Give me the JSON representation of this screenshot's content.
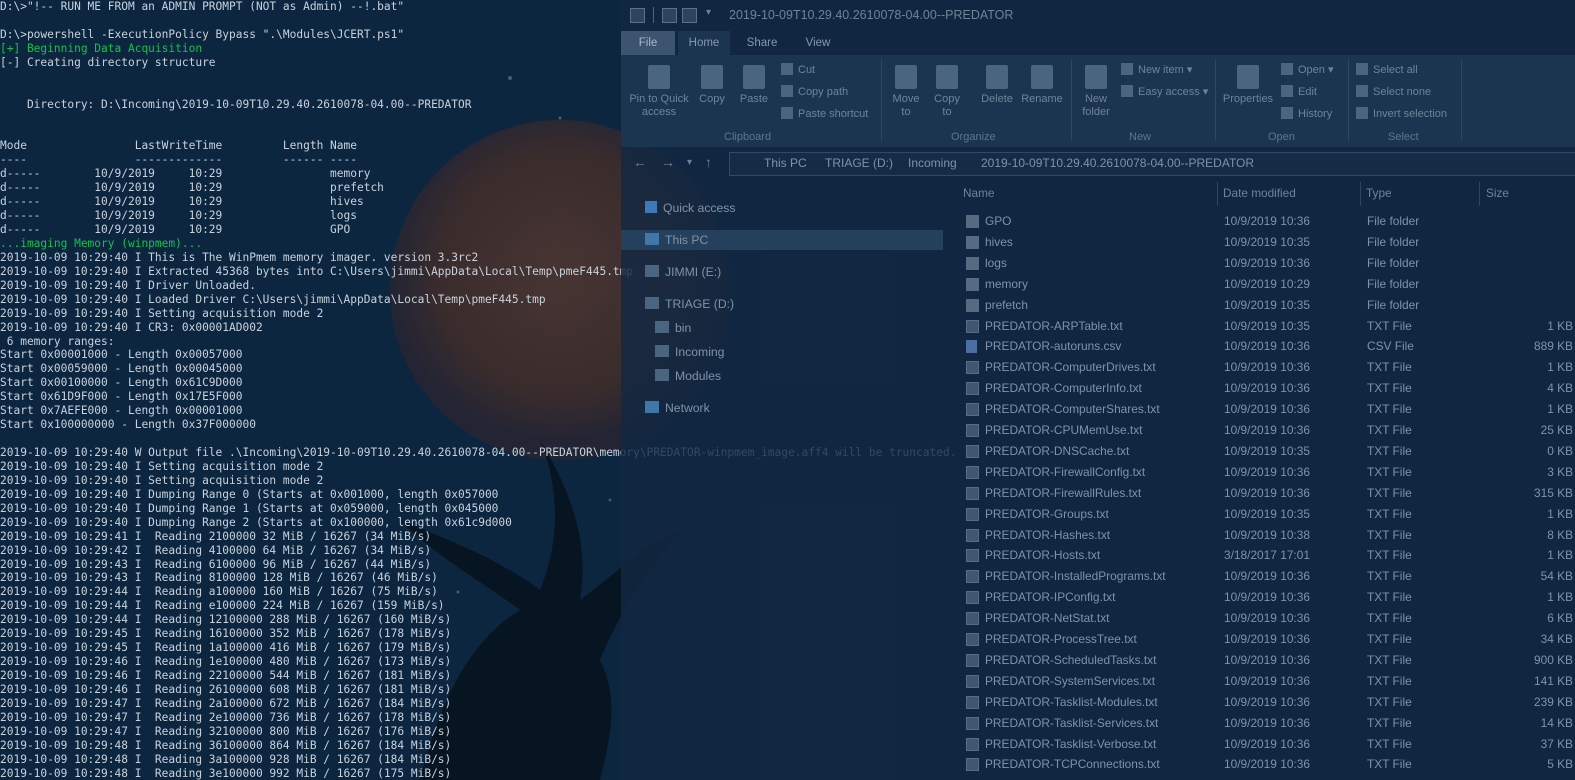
{
  "terminal": {
    "lines": [
      {
        "text": "D:\\>\"!-- RUN ME FROM an ADMIN PROMPT (NOT as Admin) --!.bat\"",
        "color": "normal"
      },
      {
        "text": "",
        "color": "normal"
      },
      {
        "text": "D:\\>powershell -ExecutionPolicy Bypass \".\\Modules\\JCERT.ps1\"",
        "color": "normal"
      },
      {
        "text": "[+] Beginning Data Acquisition",
        "color": "green"
      },
      {
        "text": "[-] Creating directory structure",
        "color": "normal"
      },
      {
        "text": "",
        "color": "normal"
      },
      {
        "text": "",
        "color": "normal"
      },
      {
        "text": "    Directory: D:\\Incoming\\2019-10-09T10.29.40.2610078-04.00--PREDATOR",
        "color": "normal"
      },
      {
        "text": "",
        "color": "normal"
      },
      {
        "text": "",
        "color": "normal"
      },
      {
        "text": "Mode                LastWriteTime         Length Name",
        "color": "normal"
      },
      {
        "text": "----                -------------         ------ ----",
        "color": "normal"
      },
      {
        "text": "d-----        10/9/2019     10:29                memory",
        "color": "normal"
      },
      {
        "text": "d-----        10/9/2019     10:29                prefetch",
        "color": "normal"
      },
      {
        "text": "d-----        10/9/2019     10:29                hives",
        "color": "normal"
      },
      {
        "text": "d-----        10/9/2019     10:29                logs",
        "color": "normal"
      },
      {
        "text": "d-----        10/9/2019     10:29                GPO",
        "color": "normal"
      },
      {
        "text": "...imaging Memory (winpmem)...",
        "color": "green"
      },
      {
        "text": "2019-10-09 10:29:40 I This is The WinPmem memory imager. version 3.3rc2",
        "color": "normal"
      },
      {
        "text": "2019-10-09 10:29:40 I Extracted 45368 bytes into C:\\Users\\jimmi\\AppData\\Local\\Temp\\pmeF445.tmp",
        "color": "normal"
      },
      {
        "text": "2019-10-09 10:29:40 I Driver Unloaded.",
        "color": "normal"
      },
      {
        "text": "2019-10-09 10:29:40 I Loaded Driver C:\\Users\\jimmi\\AppData\\Local\\Temp\\pmeF445.tmp",
        "color": "normal"
      },
      {
        "text": "2019-10-09 10:29:40 I Setting acquisition mode 2",
        "color": "normal"
      },
      {
        "text": "2019-10-09 10:29:40 I CR3: 0x00001AD002",
        "color": "normal"
      },
      {
        "text": " 6 memory ranges:",
        "color": "normal"
      },
      {
        "text": "Start 0x00001000 - Length 0x00057000",
        "color": "normal"
      },
      {
        "text": "Start 0x00059000 - Length 0x00045000",
        "color": "normal"
      },
      {
        "text": "Start 0x00100000 - Length 0x61C9D000",
        "color": "normal"
      },
      {
        "text": "Start 0x61D9F000 - Length 0x17E5F000",
        "color": "normal"
      },
      {
        "text": "Start 0x7AEFE000 - Length 0x00001000",
        "color": "normal"
      },
      {
        "text": "Start 0x100000000 - Length 0x37F000000",
        "color": "normal"
      },
      {
        "text": "",
        "color": "normal"
      },
      {
        "text": "2019-10-09 10:29:40 W Output file .\\Incoming\\2019-10-09T10.29.40.2610078-04.00--PREDATOR\\memory\\PREDATOR-winpmem_image.aff4 will be truncated.",
        "color": "normal"
      },
      {
        "text": "2019-10-09 10:29:40 I Setting acquisition mode 2",
        "color": "normal"
      },
      {
        "text": "2019-10-09 10:29:40 I Setting acquisition mode 2",
        "color": "normal"
      },
      {
        "text": "2019-10-09 10:29:40 I Dumping Range 0 (Starts at 0x001000, length 0x057000",
        "color": "normal"
      },
      {
        "text": "2019-10-09 10:29:40 I Dumping Range 1 (Starts at 0x059000, length 0x045000",
        "color": "normal"
      },
      {
        "text": "2019-10-09 10:29:40 I Dumping Range 2 (Starts at 0x100000, length 0x61c9d000",
        "color": "normal"
      },
      {
        "text": "2019-10-09 10:29:41 I  Reading 2100000 32 MiB / 16267 (34 MiB/s)",
        "color": "normal"
      },
      {
        "text": "2019-10-09 10:29:42 I  Reading 4100000 64 MiB / 16267 (34 MiB/s)",
        "color": "normal"
      },
      {
        "text": "2019-10-09 10:29:43 I  Reading 6100000 96 MiB / 16267 (44 MiB/s)",
        "color": "normal"
      },
      {
        "text": "2019-10-09 10:29:43 I  Reading 8100000 128 MiB / 16267 (46 MiB/s)",
        "color": "normal"
      },
      {
        "text": "2019-10-09 10:29:44 I  Reading a100000 160 MiB / 16267 (75 MiB/s)",
        "color": "normal"
      },
      {
        "text": "2019-10-09 10:29:44 I  Reading e100000 224 MiB / 16267 (159 MiB/s)",
        "color": "normal"
      },
      {
        "text": "2019-10-09 10:29:44 I  Reading 12100000 288 MiB / 16267 (160 MiB/s)",
        "color": "normal"
      },
      {
        "text": "2019-10-09 10:29:45 I  Reading 16100000 352 MiB / 16267 (178 MiB/s)",
        "color": "normal"
      },
      {
        "text": "2019-10-09 10:29:45 I  Reading 1a100000 416 MiB / 16267 (179 MiB/s)",
        "color": "normal"
      },
      {
        "text": "2019-10-09 10:29:46 I  Reading 1e100000 480 MiB / 16267 (173 MiB/s)",
        "color": "normal"
      },
      {
        "text": "2019-10-09 10:29:46 I  Reading 22100000 544 MiB / 16267 (181 MiB/s)",
        "color": "normal"
      },
      {
        "text": "2019-10-09 10:29:46 I  Reading 26100000 608 MiB / 16267 (181 MiB/s)",
        "color": "normal"
      },
      {
        "text": "2019-10-09 10:29:47 I  Reading 2a100000 672 MiB / 16267 (184 MiB/s)",
        "color": "normal"
      },
      {
        "text": "2019-10-09 10:29:47 I  Reading 2e100000 736 MiB / 16267 (178 MiB/s)",
        "color": "normal"
      },
      {
        "text": "2019-10-09 10:29:47 I  Reading 32100000 800 MiB / 16267 (176 MiB/s)",
        "color": "normal"
      },
      {
        "text": "2019-10-09 10:29:48 I  Reading 36100000 864 MiB / 16267 (184 MiB/s)",
        "color": "normal"
      },
      {
        "text": "2019-10-09 10:29:48 I  Reading 3a100000 928 MiB / 16267 (184 MiB/s)",
        "color": "normal"
      },
      {
        "text": "2019-10-09 10:29:48 I  Reading 3e100000 992 MiB / 16267 (175 MiB/s)",
        "color": "normal"
      }
    ]
  },
  "explorer": {
    "title": "2019-10-09T10.29.40.2610078-04.00--PREDATOR",
    "tabs": [
      "File",
      "Home",
      "Share",
      "View"
    ],
    "ribbon": {
      "pin_to_quick_access": "Pin to Quick access",
      "copy": "Copy",
      "paste": "Paste",
      "cut": "Cut",
      "copy_path": "Copy path",
      "paste_shortcut": "Paste shortcut",
      "move_to": "Move to",
      "copy_to": "Copy to",
      "delete": "Delete",
      "rename": "Rename",
      "new_folder": "New folder",
      "new_item": "New item",
      "easy_access": "Easy access",
      "properties": "Properties",
      "open": "Open",
      "edit": "Edit",
      "history": "History",
      "select_all": "Select all",
      "select_none": "Select none",
      "invert_selection": "Invert selection",
      "groups": {
        "clipboard": "Clipboard",
        "organize": "Organize",
        "new": "New",
        "open": "Open",
        "select": "Select"
      }
    },
    "breadcrumb": [
      "This PC",
      "TRIAGE (D:)",
      "Incoming",
      "2019-10-09T10.29.40.2610078-04.00--PREDATOR"
    ],
    "nav": {
      "quick_access": "Quick access",
      "this_pc": "This PC",
      "jimmi": "JIMMI (E:)",
      "triage": "TRIAGE (D:)",
      "bin": "bin",
      "incoming": "Incoming",
      "modules": "Modules",
      "network": "Network"
    },
    "columns": {
      "name": "Name",
      "date": "Date modified",
      "type": "Type",
      "size": "Size"
    },
    "files": [
      {
        "name": "GPO",
        "date": "10/9/2019 10:36",
        "type": "File folder",
        "size": "",
        "icon": "folder-icon"
      },
      {
        "name": "hives",
        "date": "10/9/2019 10:35",
        "type": "File folder",
        "size": "",
        "icon": "folder-icon"
      },
      {
        "name": "logs",
        "date": "10/9/2019 10:36",
        "type": "File folder",
        "size": "",
        "icon": "folder-icon"
      },
      {
        "name": "memory",
        "date": "10/9/2019 10:29",
        "type": "File folder",
        "size": "",
        "icon": "folder-icon"
      },
      {
        "name": "prefetch",
        "date": "10/9/2019 10:35",
        "type": "File folder",
        "size": "",
        "icon": "folder-icon"
      },
      {
        "name": "PREDATOR-ARPTable.txt",
        "date": "10/9/2019 10:35",
        "type": "TXT File",
        "size": "1 KB",
        "icon": "txt-file-icon"
      },
      {
        "name": "PREDATOR-autoruns.csv",
        "date": "10/9/2019 10:36",
        "type": "CSV File",
        "size": "889 KB",
        "icon": "csv-file-icon"
      },
      {
        "name": "PREDATOR-ComputerDrives.txt",
        "date": "10/9/2019 10:36",
        "type": "TXT File",
        "size": "1 KB",
        "icon": "txt-file-icon"
      },
      {
        "name": "PREDATOR-ComputerInfo.txt",
        "date": "10/9/2019 10:36",
        "type": "TXT File",
        "size": "4 KB",
        "icon": "txt-file-icon"
      },
      {
        "name": "PREDATOR-ComputerShares.txt",
        "date": "10/9/2019 10:36",
        "type": "TXT File",
        "size": "1 KB",
        "icon": "txt-file-icon"
      },
      {
        "name": "PREDATOR-CPUMemUse.txt",
        "date": "10/9/2019 10:36",
        "type": "TXT File",
        "size": "25 KB",
        "icon": "txt-file-icon"
      },
      {
        "name": "PREDATOR-DNSCache.txt",
        "date": "10/9/2019 10:35",
        "type": "TXT File",
        "size": "0 KB",
        "icon": "txt-file-icon"
      },
      {
        "name": "PREDATOR-FirewallConfig.txt",
        "date": "10/9/2019 10:36",
        "type": "TXT File",
        "size": "3 KB",
        "icon": "txt-file-icon"
      },
      {
        "name": "PREDATOR-FirewallRules.txt",
        "date": "10/9/2019 10:36",
        "type": "TXT File",
        "size": "315 KB",
        "icon": "txt-file-icon"
      },
      {
        "name": "PREDATOR-Groups.txt",
        "date": "10/9/2019 10:35",
        "type": "TXT File",
        "size": "1 KB",
        "icon": "txt-file-icon"
      },
      {
        "name": "PREDATOR-Hashes.txt",
        "date": "10/9/2019 10:38",
        "type": "TXT File",
        "size": "8 KB",
        "icon": "txt-file-icon"
      },
      {
        "name": "PREDATOR-Hosts.txt",
        "date": "3/18/2017 17:01",
        "type": "TXT File",
        "size": "1 KB",
        "icon": "txt-file-icon"
      },
      {
        "name": "PREDATOR-InstalledPrograms.txt",
        "date": "10/9/2019 10:36",
        "type": "TXT File",
        "size": "54 KB",
        "icon": "txt-file-icon"
      },
      {
        "name": "PREDATOR-IPConfig.txt",
        "date": "10/9/2019 10:36",
        "type": "TXT File",
        "size": "1 KB",
        "icon": "txt-file-icon"
      },
      {
        "name": "PREDATOR-NetStat.txt",
        "date": "10/9/2019 10:36",
        "type": "TXT File",
        "size": "6 KB",
        "icon": "txt-file-icon"
      },
      {
        "name": "PREDATOR-ProcessTree.txt",
        "date": "10/9/2019 10:36",
        "type": "TXT File",
        "size": "34 KB",
        "icon": "txt-file-icon"
      },
      {
        "name": "PREDATOR-ScheduledTasks.txt",
        "date": "10/9/2019 10:36",
        "type": "TXT File",
        "size": "900 KB",
        "icon": "txt-file-icon"
      },
      {
        "name": "PREDATOR-SystemServices.txt",
        "date": "10/9/2019 10:36",
        "type": "TXT File",
        "size": "141 KB",
        "icon": "txt-file-icon"
      },
      {
        "name": "PREDATOR-Tasklist-Modules.txt",
        "date": "10/9/2019 10:36",
        "type": "TXT File",
        "size": "239 KB",
        "icon": "txt-file-icon"
      },
      {
        "name": "PREDATOR-Tasklist-Services.txt",
        "date": "10/9/2019 10:36",
        "type": "TXT File",
        "size": "14 KB",
        "icon": "txt-file-icon"
      },
      {
        "name": "PREDATOR-Tasklist-Verbose.txt",
        "date": "10/9/2019 10:36",
        "type": "TXT File",
        "size": "37 KB",
        "icon": "txt-file-icon"
      },
      {
        "name": "PREDATOR-TCPConnections.txt",
        "date": "10/9/2019 10:36",
        "type": "TXT File",
        "size": "5 KB",
        "icon": "txt-file-icon"
      }
    ]
  }
}
